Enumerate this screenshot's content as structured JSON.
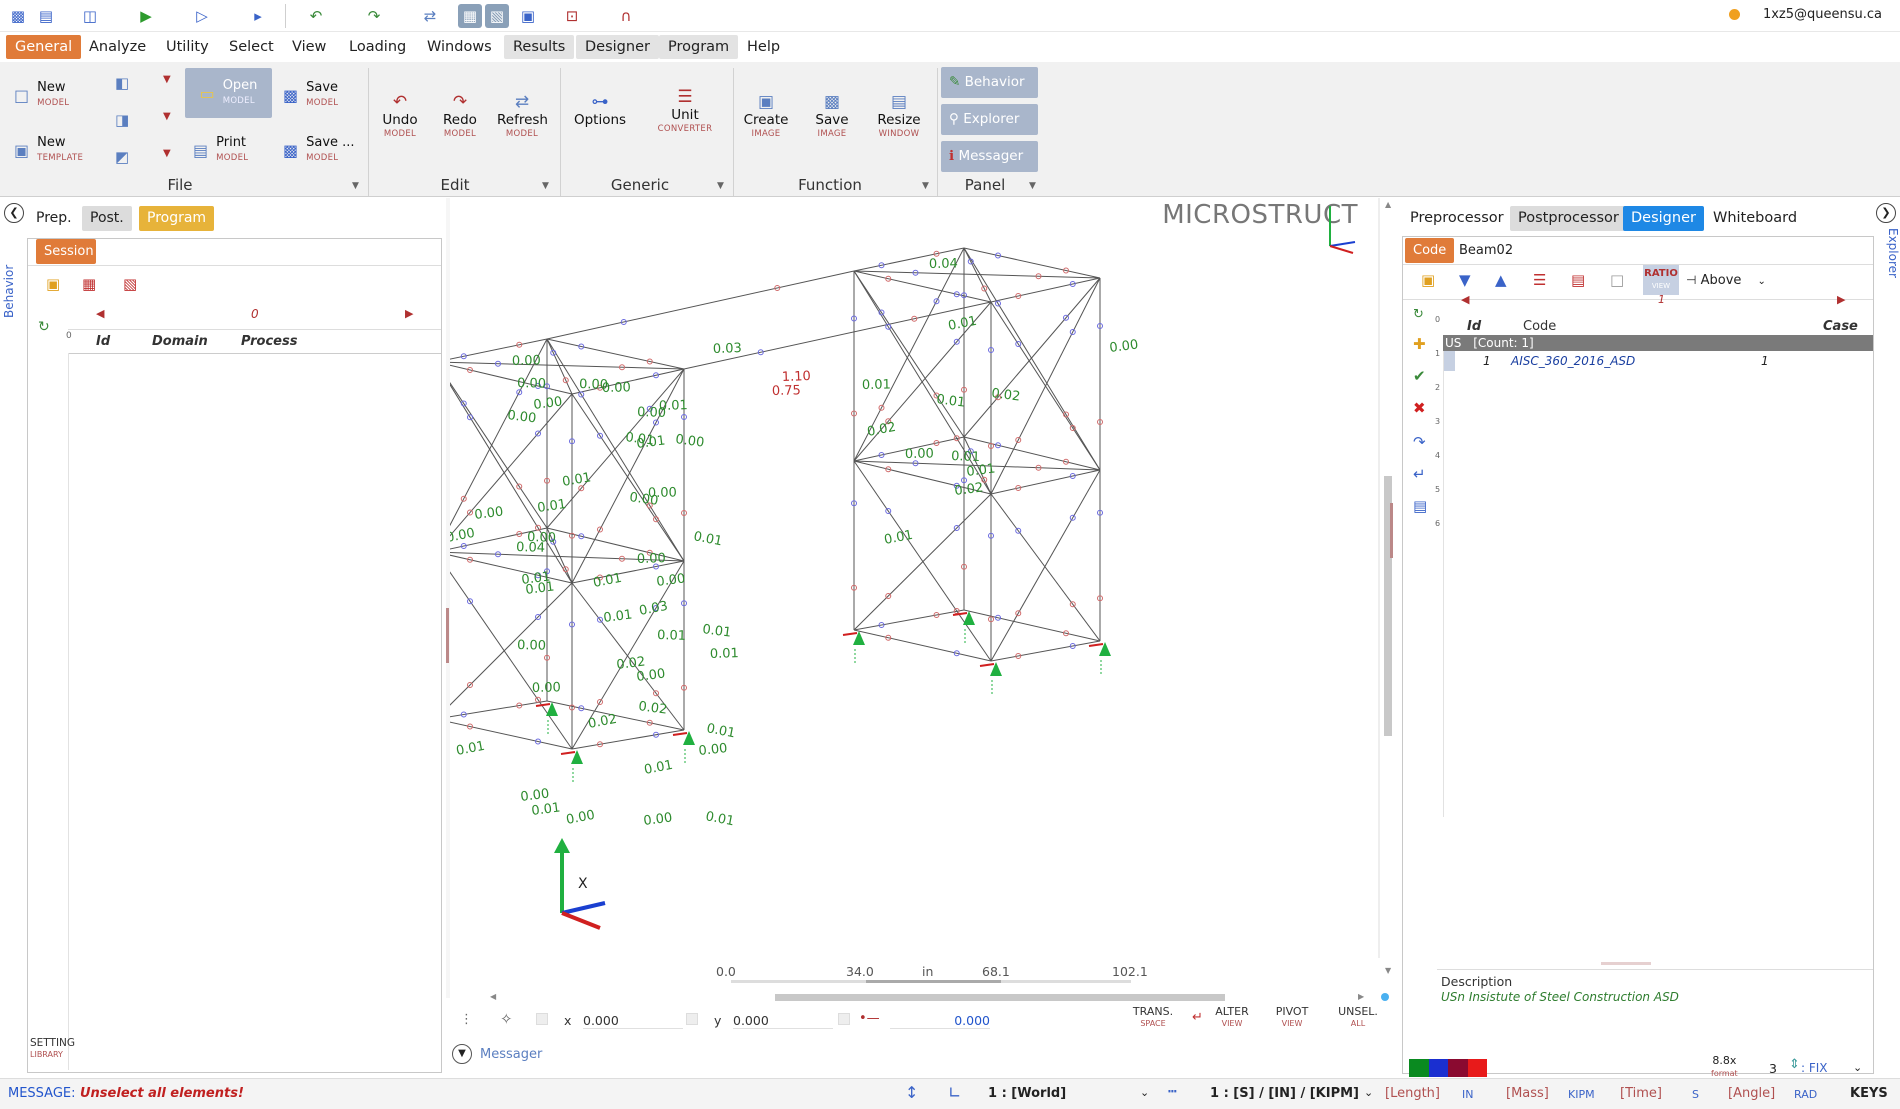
{
  "header": {
    "user": "1xz5@queensu.ca"
  },
  "menu": [
    "General",
    "Analyze",
    "Utility",
    "Select",
    "View",
    "Loading",
    "Windows",
    "Results",
    "Designer",
    "Program",
    "Help"
  ],
  "ribbon": {
    "file": {
      "new_model": {
        "label": "New",
        "sub": "MODEL"
      },
      "new_template": {
        "label": "New",
        "sub": "TEMPLATE"
      },
      "open_model": {
        "label": "Open",
        "sub": "MODEL"
      },
      "print_model": {
        "label": "Print",
        "sub": "MODEL"
      },
      "save_model": {
        "label": "Save",
        "sub": "MODEL"
      },
      "save_as_model": {
        "label": "Save ...",
        "sub": "MODEL"
      },
      "group": "File"
    },
    "edit": {
      "undo": {
        "label": "Undo",
        "sub": "MODEL"
      },
      "redo": {
        "label": "Redo",
        "sub": "MODEL"
      },
      "refresh": {
        "label": "Refresh",
        "sub": "MODEL"
      },
      "group": "Edit"
    },
    "generic": {
      "options": {
        "label": "Options"
      },
      "unit": {
        "label": "Unit",
        "sub": "CONVERTER"
      },
      "group": "Generic"
    },
    "function": {
      "create": {
        "label": "Create",
        "sub": "IMAGE"
      },
      "save": {
        "label": "Save",
        "sub": "IMAGE"
      },
      "resize": {
        "label": "Resize",
        "sub": "WINDOW"
      },
      "group": "Function"
    },
    "panel": {
      "behavior": "Behavior",
      "explorer": "Explorer",
      "messager": "Messager",
      "group": "Panel"
    }
  },
  "left_panel": {
    "side_label": "Behavior",
    "tabs": [
      "Prep.",
      "Post.",
      "Program"
    ],
    "session_tab": "Session",
    "nav_value": "0",
    "row_marker": "0",
    "columns": [
      "Id",
      "Domain",
      "Process"
    ],
    "setting": {
      "label": "SETTING",
      "sub": "LIBRARY"
    }
  },
  "viewport": {
    "brand": "MICROSTRUCT",
    "scale_ticks": [
      "0.0",
      "34.0",
      "in",
      "68.1",
      "102.1"
    ],
    "x_label": "x",
    "x_value": "0.000",
    "y_label": "y",
    "y_value": "0.000",
    "dist_value": "0.000",
    "trans": {
      "label": "TRANS.",
      "sub": "SPACE"
    },
    "alter": {
      "label": "ALTER",
      "sub": "VIEW"
    },
    "pivot": {
      "label": "PIVOT",
      "sub": "VIEW"
    },
    "unsel": {
      "label": "UNSEL.",
      "sub": "ALL"
    },
    "messager_label": "Messager",
    "ratios": [
      "0.00",
      "0.00",
      "0.00",
      "0.00",
      "0.00",
      "0.00",
      "0.03",
      "0.75",
      "0.00",
      "0.00",
      "0.01",
      "0.01",
      "0.01",
      "1.10",
      "0.01",
      "0.00",
      "0.01",
      "0.00",
      "0.00",
      "0.00",
      "0.01",
      "0.01",
      "0.01",
      "0.01",
      "0.00",
      "0.00",
      "0.01",
      "0.01",
      "0.00",
      "0.04",
      "0.03",
      "0.01",
      "0.02",
      "0.00",
      "0.00",
      "0.01",
      "0.00",
      "0.02",
      "0.02",
      "0.01",
      "0.01",
      "0.00",
      "0.01",
      "0.00",
      "0.01",
      "0.00",
      "0.00",
      "0.01",
      "0.04",
      "0.01",
      "0.01",
      "0.02",
      "0.00",
      "0.01",
      "0.01",
      "0.01",
      "0.02",
      "0.01",
      "0.02",
      "0.00"
    ]
  },
  "right_panel": {
    "side_label": "Explorer",
    "tabs": [
      "Preprocessor",
      "Postprocessor",
      "Designer",
      "Whiteboard"
    ],
    "sub_tabs": [
      "Code",
      "Beam02"
    ],
    "ratio_btn": {
      "label": "RATIO",
      "sub": "VIEW"
    },
    "above": "Above",
    "nav_value": "1",
    "columns": [
      "Id",
      "Code",
      "Case"
    ],
    "group_row": {
      "tag": "US",
      "text": "[Count: 1]"
    },
    "rows": [
      {
        "id": "1",
        "code": "AISC_360_2016_ASD",
        "case": "1"
      }
    ],
    "row_numbers": [
      "0",
      "1",
      "2",
      "3",
      "4",
      "5",
      "6"
    ],
    "description_label": "Description",
    "description_text": "USn Insistute of Steel Construction ASD",
    "format": {
      "label": "8.8x",
      "sub": "format"
    },
    "precision": "3",
    "fix": ": FIX"
  },
  "status": {
    "message_label": "MESSAGE:",
    "message_text": "Unselect all elements!",
    "coord_system": "1 : [World]",
    "unit_system": "1 : [S] / [IN] / [KIPM]",
    "length_label": "[Length]",
    "length_val": "IN",
    "mass_label": "[Mass]",
    "mass_val": "KIPM",
    "time_label": "[Time]",
    "time_val": "S",
    "angle_label": "[Angle]",
    "angle_val": "RAD",
    "keys": "KEYS"
  },
  "colors": {
    "accent": "#e07b39",
    "program": "#e7b33a",
    "designer_blue": "#1e88e5",
    "ratio_green": "#2e8b2e",
    "ratio_red": "#c03030"
  }
}
